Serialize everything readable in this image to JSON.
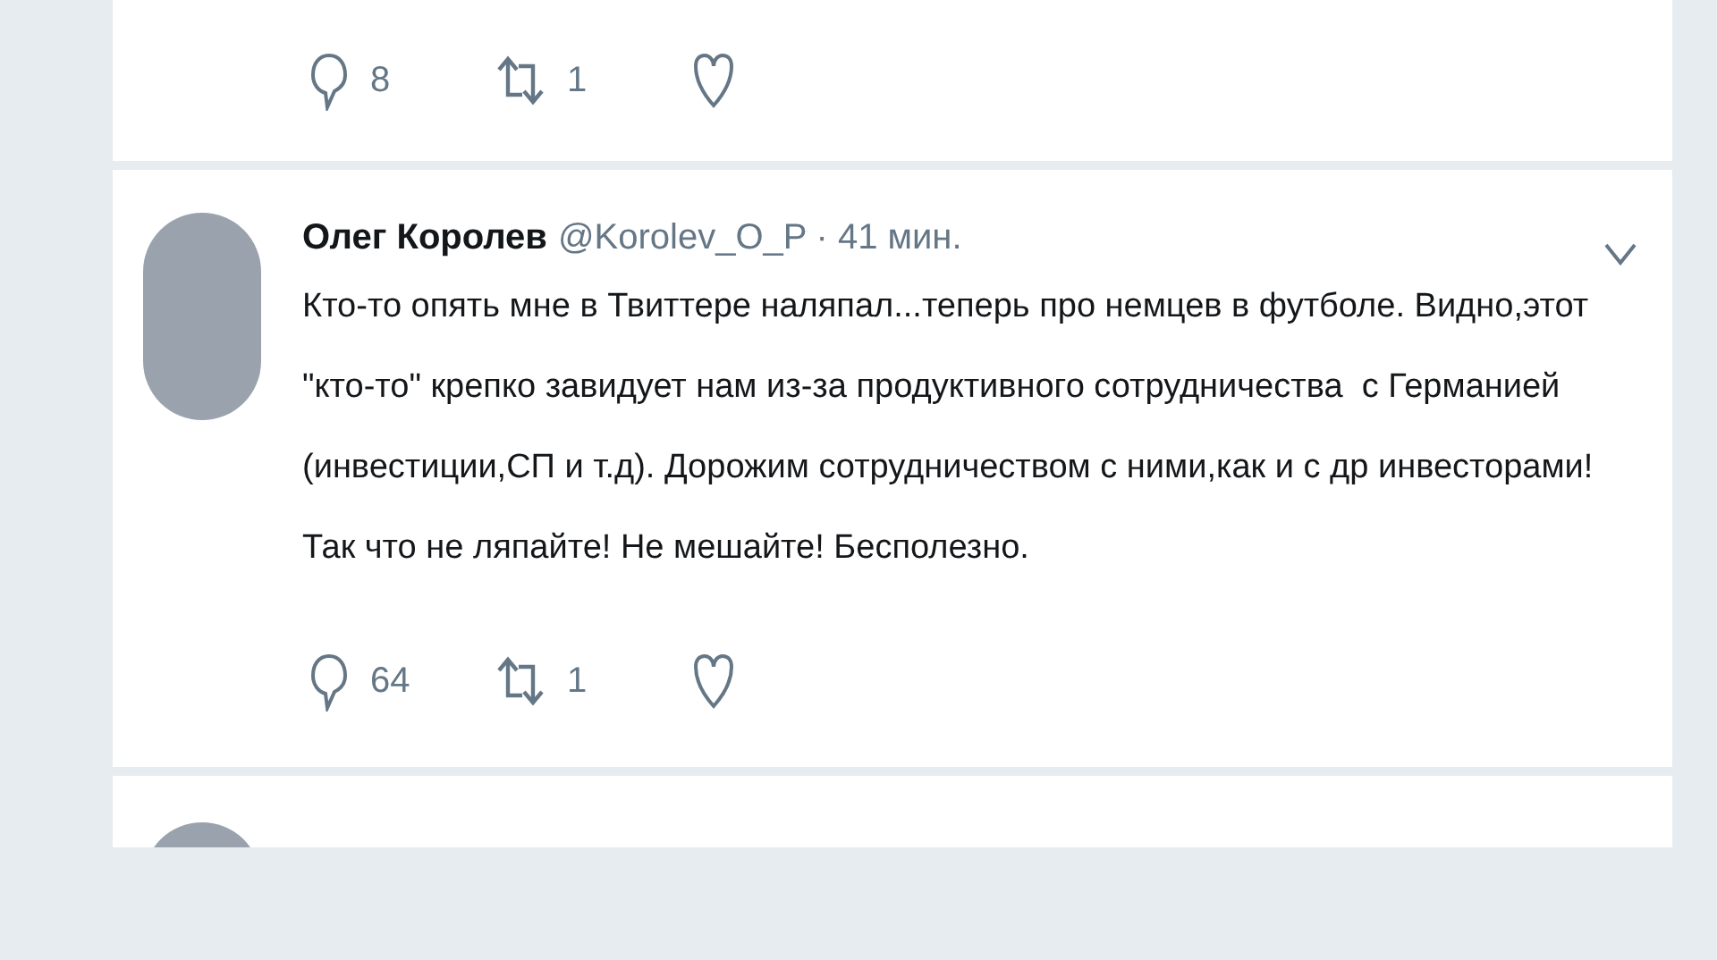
{
  "tweets": [
    {
      "kind": "actions_only",
      "replies": "8",
      "retweets": "1"
    },
    {
      "kind": "full",
      "author": "Олег Королев",
      "handle": "@Korolev_O_P",
      "time": "· 41 мин.",
      "text": "Кто-то опять мне в Твиттере наляпал...теперь про немцев в футболе. Видно,этот  \"кто-то\" крепко завидует нам из-за продуктивного сотрудничества  с Германией (инвестиции,СП и т.д). Дорожим сотрудничеством с ними,как и с др инвесторами! Так что не ляпайте! Не мешайте! Бесполезно.",
      "replies": "64",
      "retweets": "1"
    },
    {
      "kind": "cut_off"
    }
  ]
}
